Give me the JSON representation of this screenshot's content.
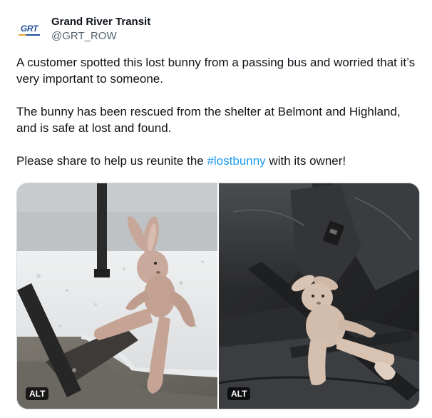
{
  "account": {
    "display_name": "Grand River Transit",
    "handle": "@GRT_ROW",
    "avatar_logo_text": "GRT"
  },
  "tweet": {
    "paragraph1": "A customer spotted this lost bunny from a passing bus and worried that it’s very important to someone.",
    "paragraph2": "The bunny has been rescued from the shelter at Belmont and Highland, and is safe at lost and found.",
    "paragraph3_before": "Please share to help us reunite the ",
    "hashtag": "#lostbunny",
    "paragraph3_after": " with its owner!"
  },
  "media": {
    "left_alt_label": "ALT",
    "right_alt_label": "ALT"
  },
  "colors": {
    "link": "#1d9bf0",
    "text": "#0f1419",
    "secondary": "#536471",
    "brand_blue": "#1f4f9c",
    "brand_orange": "#e8a23a"
  }
}
